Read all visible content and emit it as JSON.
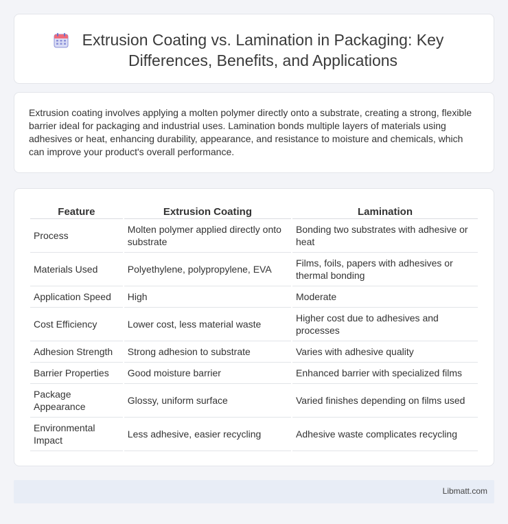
{
  "header": {
    "title": "Extrusion Coating vs. Lamination in Packaging: Key Differences, Benefits, and Applications",
    "icon": "calendar-icon"
  },
  "intro": {
    "text": "Extrusion coating involves applying a molten polymer directly onto a substrate, creating a strong, flexible barrier ideal for packaging and industrial uses. Lamination bonds multiple layers of materials using adhesives or heat, enhancing durability, appearance, and resistance to moisture and chemicals, which can improve your product's overall performance."
  },
  "table": {
    "headers": [
      "Feature",
      "Extrusion Coating",
      "Lamination"
    ],
    "rows": [
      [
        "Process",
        "Molten polymer applied directly onto substrate",
        "Bonding two substrates with adhesive or heat"
      ],
      [
        "Materials Used",
        "Polyethylene, polypropylene, EVA",
        "Films, foils, papers with adhesives or thermal bonding"
      ],
      [
        "Application Speed",
        "High",
        "Moderate"
      ],
      [
        "Cost Efficiency",
        "Lower cost, less material waste",
        "Higher cost due to adhesives and processes"
      ],
      [
        "Adhesion Strength",
        "Strong adhesion to substrate",
        "Varies with adhesive quality"
      ],
      [
        "Barrier Properties",
        "Good moisture barrier",
        "Enhanced barrier with specialized films"
      ],
      [
        "Package Appearance",
        "Glossy, uniform surface",
        "Varied finishes depending on films used"
      ],
      [
        "Environmental Impact",
        "Less adhesive, easier recycling",
        "Adhesive waste complicates recycling"
      ]
    ]
  },
  "footer": {
    "brand": "Libmatt.com"
  }
}
